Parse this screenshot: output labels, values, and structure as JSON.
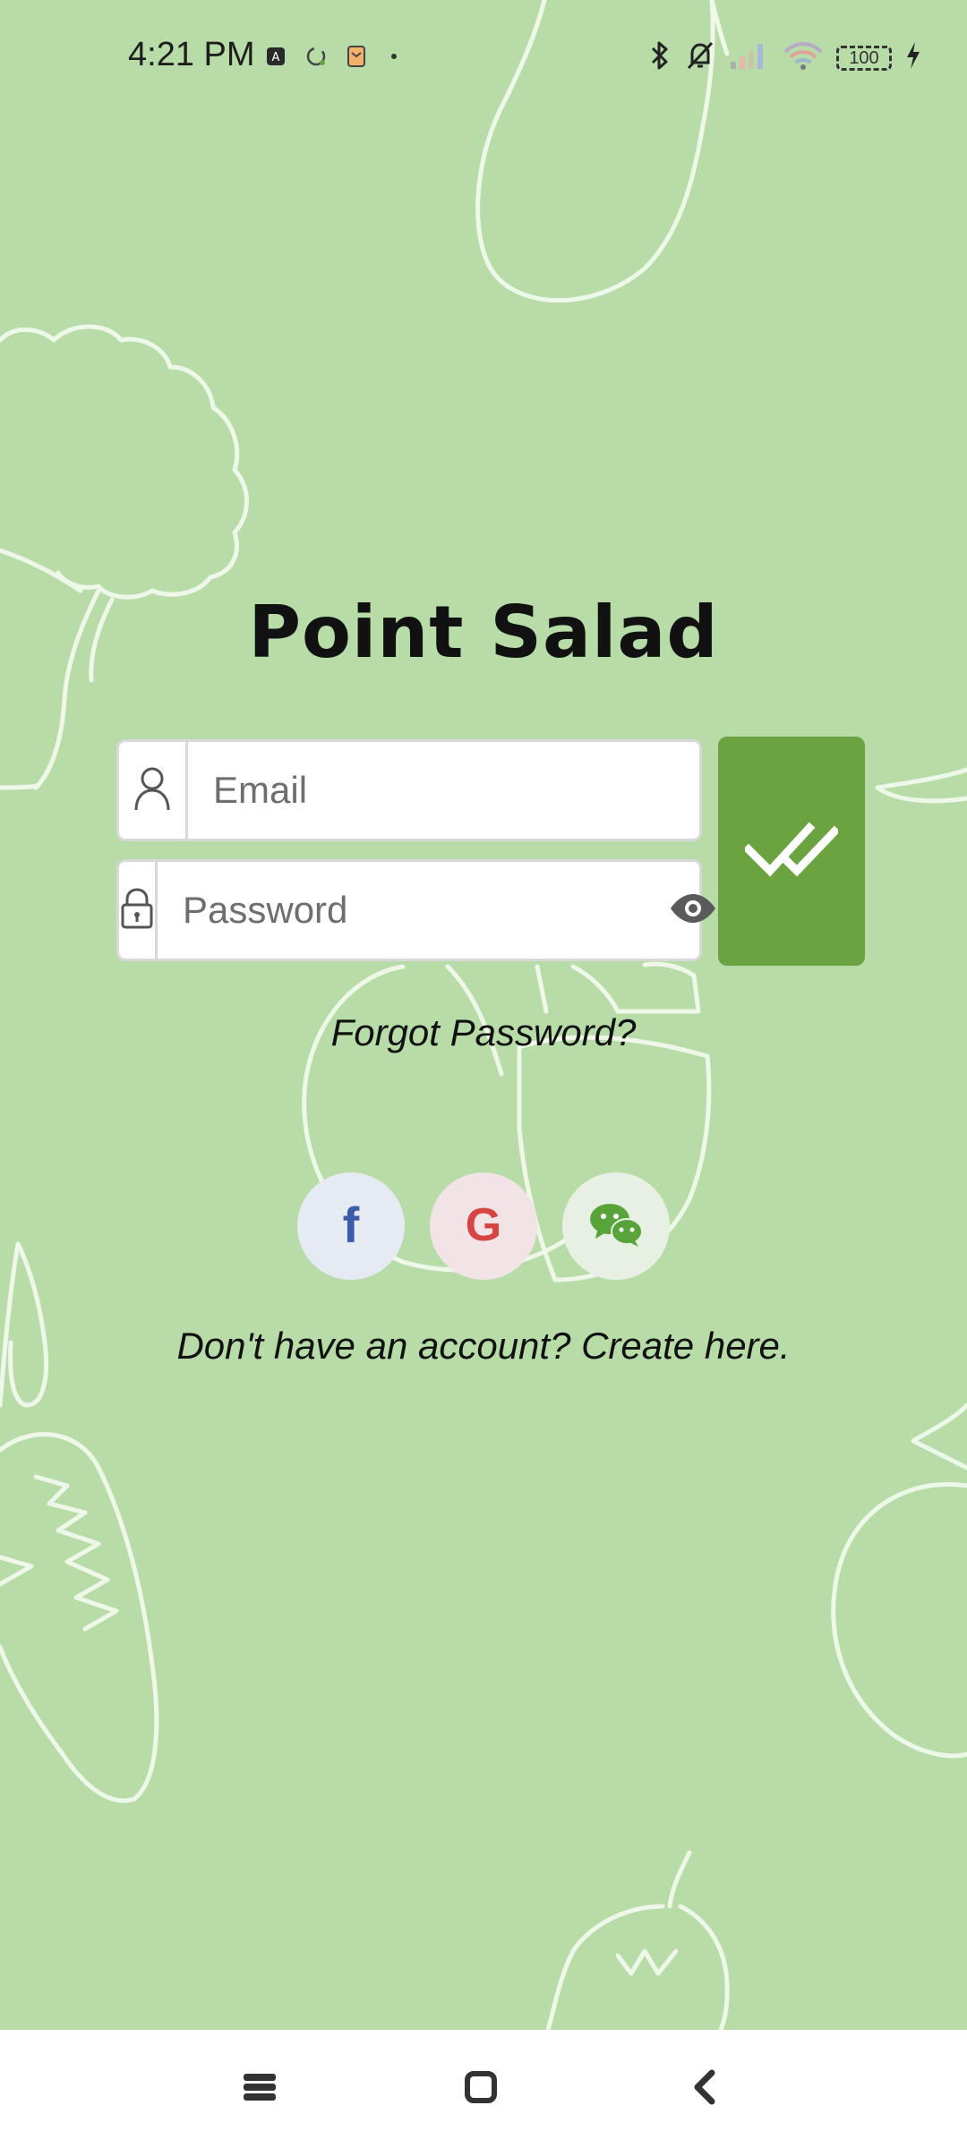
{
  "status_bar": {
    "time": "4:21 PM",
    "battery_level": "100",
    "notification_icons": [
      "app-notification-icon",
      "sync-icon",
      "mail-icon",
      "dot-icon"
    ],
    "system_icons": [
      "bluetooth-icon",
      "silent-bell-icon",
      "signal-icon",
      "wifi-icon",
      "battery-icon",
      "charging-icon"
    ]
  },
  "app": {
    "title": "Point Salad"
  },
  "login": {
    "email_placeholder": "Email",
    "email_value": "",
    "password_placeholder": "Password",
    "password_value": "",
    "submit_icon": "double-check-icon"
  },
  "links": {
    "forgot_password": "Forgot Password?",
    "create_account": "Don't have an account? Create here."
  },
  "social": {
    "providers": [
      "facebook",
      "google",
      "wechat"
    ],
    "facebook_letter": "f",
    "google_letter": "G"
  },
  "colors": {
    "background": "#b8dca8",
    "accent": "#6aa33f",
    "facebook": "#3b5ca8",
    "google": "#d64541",
    "wechat": "#58a43a"
  },
  "nav_bar": {
    "buttons": [
      "menu-button",
      "home-button",
      "back-button"
    ]
  }
}
